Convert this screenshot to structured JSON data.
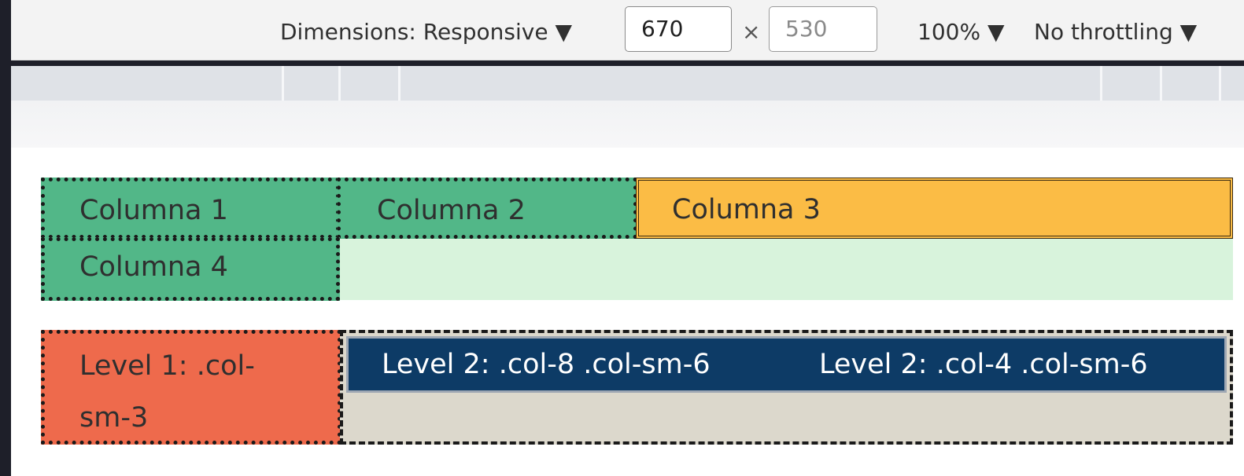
{
  "toolbar": {
    "dimensions_label": "Dimensions: Responsive ▼",
    "width_value": "670",
    "times_symbol": "×",
    "height_value": "530",
    "zoom_label": "100% ▼",
    "throttle_label": "No throttling ▼"
  },
  "row1": {
    "col1": "Columna 1",
    "col2": "Columna 2",
    "col3": "Columna 3",
    "col4": "Columna 4"
  },
  "row2": {
    "level1_line1": "Level 1: .col-",
    "level1_line2": "sm-3",
    "level2_a": "Level 2: .col-8 .col-sm-6",
    "level2_b": "Level 2: .col-4 .col-sm-6"
  },
  "colors": {
    "green": "#52b788",
    "mint": "#d8f3dc",
    "amber": "#fbbc45",
    "coral": "#ee6a4c",
    "navy": "#0d3b66",
    "stone": "#dcd8cc"
  }
}
